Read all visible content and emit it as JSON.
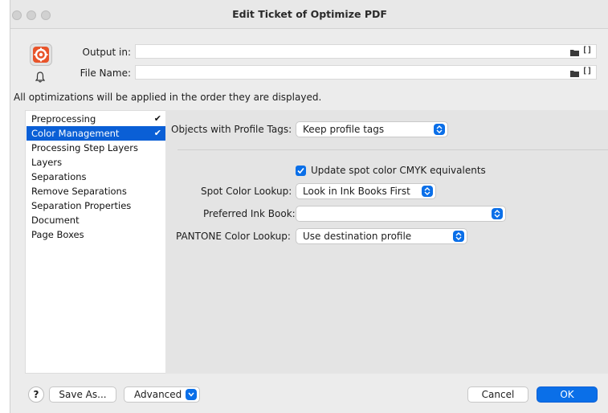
{
  "window": {
    "title": "Edit Ticket of Optimize PDF"
  },
  "header": {
    "output_label": "Output in:",
    "output_value": "",
    "filename_label": "File Name:",
    "filename_value": "",
    "bracket_glyph": "[]"
  },
  "info_text": "All optimizations will be applied in the order they are displayed.",
  "sidebar": {
    "items": [
      {
        "label": "Preprocessing",
        "checked": true,
        "selected": false
      },
      {
        "label": "Color Management",
        "checked": true,
        "selected": true
      },
      {
        "label": "Processing Step Layers",
        "checked": false,
        "selected": false
      },
      {
        "label": "Layers",
        "checked": false,
        "selected": false
      },
      {
        "label": "Separations",
        "checked": false,
        "selected": false
      },
      {
        "label": "Remove Separations",
        "checked": false,
        "selected": false
      },
      {
        "label": "Separation Properties",
        "checked": false,
        "selected": false
      },
      {
        "label": "Document",
        "checked": false,
        "selected": false
      },
      {
        "label": "Page Boxes",
        "checked": false,
        "selected": false
      }
    ],
    "check_glyph": "✔"
  },
  "color_management": {
    "profile_tags_label": "Objects with Profile Tags:",
    "profile_tags_value": "Keep profile tags",
    "update_cmyk_label": "Update spot color CMYK equivalents",
    "update_cmyk_checked": true,
    "spot_lookup_label": "Spot Color Lookup:",
    "spot_lookup_value": "Look in Ink Books First",
    "ink_book_label": "Preferred Ink Book:",
    "ink_book_value": "",
    "pantone_label": "PANTONE Color Lookup:",
    "pantone_value": "Use destination profile"
  },
  "footer": {
    "help_label": "?",
    "save_as_label": "Save As...",
    "advanced_label": "Advanced",
    "cancel_label": "Cancel",
    "ok_label": "OK"
  },
  "colors": {
    "accent": "#0a6fe8",
    "selection": "#0a5fd6",
    "app_icon": "#e8542a"
  }
}
